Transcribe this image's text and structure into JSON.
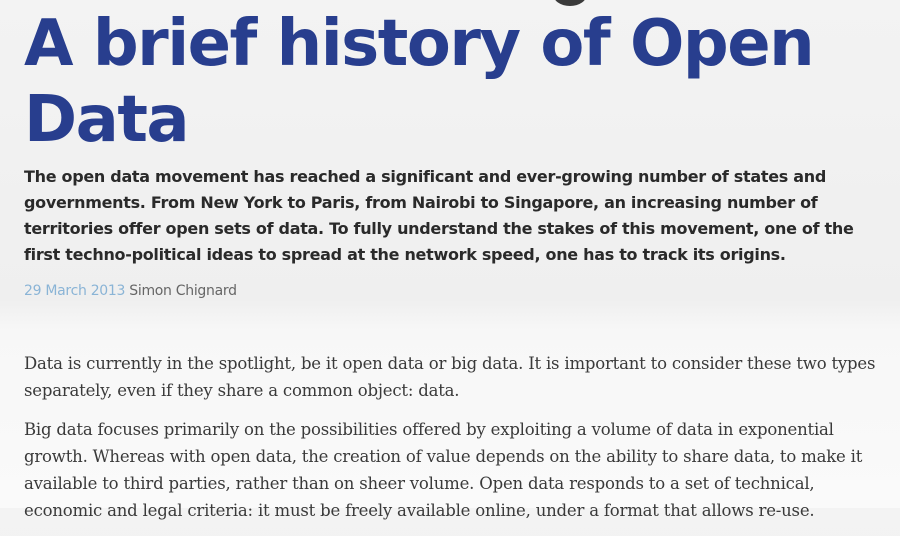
{
  "article": {
    "title": "A brief history of Open Data",
    "lead": "The open data movement has reached a significant and ever-growing number of states and governments. From New York to Paris, from Nairobi to Singapore, an increasing number of territories offer open sets of data. To fully understand the stakes of this movement, one of the first techno-political ideas to spread at the network speed, one has to track its origins.",
    "date": "29 March 2013",
    "author": "Simon Chignard",
    "paragraphs": [
      "Data is currently in the spotlight, be it open data or big data. It is important to consider these two types separately, even if they share a common object: data.",
      "Big data focuses primarily on the possibilities offered by exploiting a volume of data in exponential growth. Whereas with open data, the creation of value depends on the ability to share data, to make it available to third parties, rather than on sheer volume. Open data responds to a set of technical, economic and legal criteria: it must be freely available online, under a format that allows re-use."
    ]
  },
  "colors": {
    "title": "#283e8e",
    "date": "#8ab4d6",
    "author": "#666666",
    "body": "#3a3a3a"
  }
}
